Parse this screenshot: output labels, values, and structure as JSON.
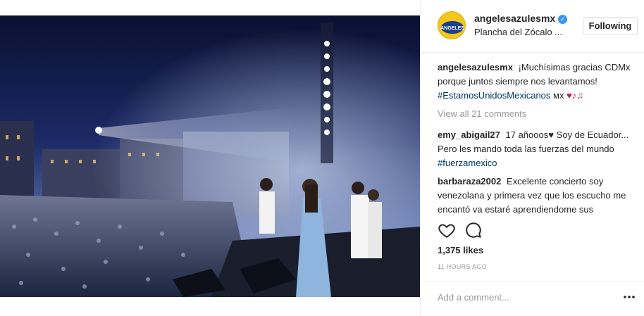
{
  "post": {
    "image_alt": "Concert stage at Zócalo with singers and crowd"
  },
  "header": {
    "username": "angelesazulesmx",
    "verified_icon": "verified-badge-icon",
    "location": "Plancha del Zócalo ...",
    "follow_label": "Following"
  },
  "caption": {
    "user": "angelesazulesmx",
    "text": " ¡Muchísimas gracias CDMx porque juntos siempre nos levantamos! ",
    "hashtag": "#EstamosUnidosMexicanos",
    "suffix": " мх ",
    "emoji": "♥♪♫"
  },
  "view_all_label": "View all 21 comments",
  "comments": [
    {
      "user": "emy_abigail27",
      "text": " 17 añooos♥ Soy de Ecuador... Pero les mando toda las fuerzas del mundo ",
      "hashtag": "#fuerzamexico"
    },
    {
      "user": "barbaraza2002",
      "text": " Excelente concierto soy venezolana y primera vez que los escucho me encantó va estaré aprendiendome sus",
      "hashtag": ""
    }
  ],
  "actions": {
    "like_icon": "heart-outline-icon",
    "comment_icon": "comment-bubble-icon"
  },
  "likes": "1,375 likes",
  "timestamp": "11 HOURS AGO",
  "add_comment": {
    "placeholder": "Add a comment...",
    "more_icon": "more-options-icon"
  }
}
